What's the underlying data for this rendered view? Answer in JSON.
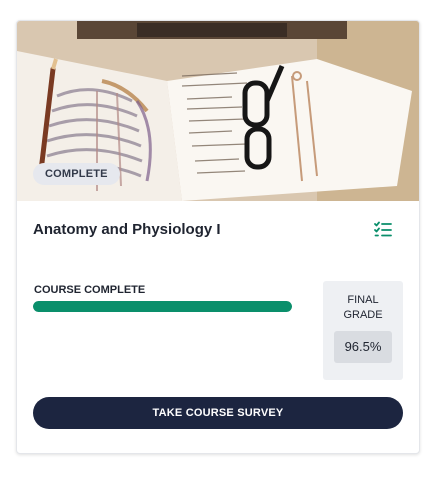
{
  "course": {
    "image_alt": "",
    "status_badge": "COMPLETE",
    "title": "Anatomy and Physiology I",
    "progress_label": "COURSE COMPLETE",
    "progress_fraction": 1.0,
    "final_grade_label": "FINAL GRADE",
    "final_grade_value": "96.5%",
    "survey_button_label": "TAKE COURSE SURVEY"
  },
  "icons": {
    "checklist": "checklist-icon"
  },
  "colors": {
    "progress": "#0a8f6b",
    "button": "#1c2540",
    "checklist_icon": "#0a8f6b"
  }
}
